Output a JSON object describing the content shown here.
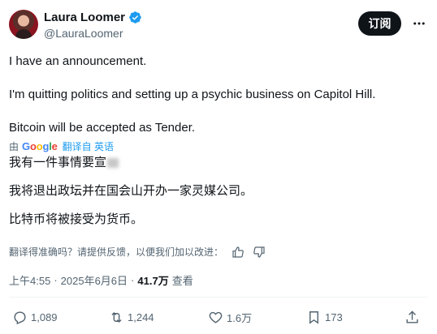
{
  "author": {
    "name": "Laura Loomer",
    "handle": "@LauraLoomer"
  },
  "header": {
    "subscribe_label": "订阅"
  },
  "tweet": {
    "lines": [
      "I have an announcement.",
      "I'm quitting politics and setting up a psychic business on Capitol Hill.",
      "Bitcoin will be accepted as Tender."
    ]
  },
  "translation": {
    "by_prefix": "由",
    "provider": "Google",
    "translated_label": "翻译自 英语",
    "lines": [
      "我有一件事情要宣",
      "我将退出政坛并在国会山开办一家灵媒公司。",
      "比特币将被接受为货币。"
    ],
    "feedback_prompt": "翻译得准确吗？请提供反馈，以便我们加以改进："
  },
  "meta": {
    "time": "上午4:55",
    "separator": "·",
    "date": "2025年6月6日",
    "views_count": "41.7万",
    "views_label": "查看"
  },
  "actions": {
    "replies": "1,089",
    "reposts": "1,244",
    "likes": "1.6万",
    "bookmarks": "173"
  },
  "colors": {
    "verified": "#1d9bf0",
    "text": "#0f1419",
    "secondary": "#536471",
    "link": "#1d9bf0"
  }
}
